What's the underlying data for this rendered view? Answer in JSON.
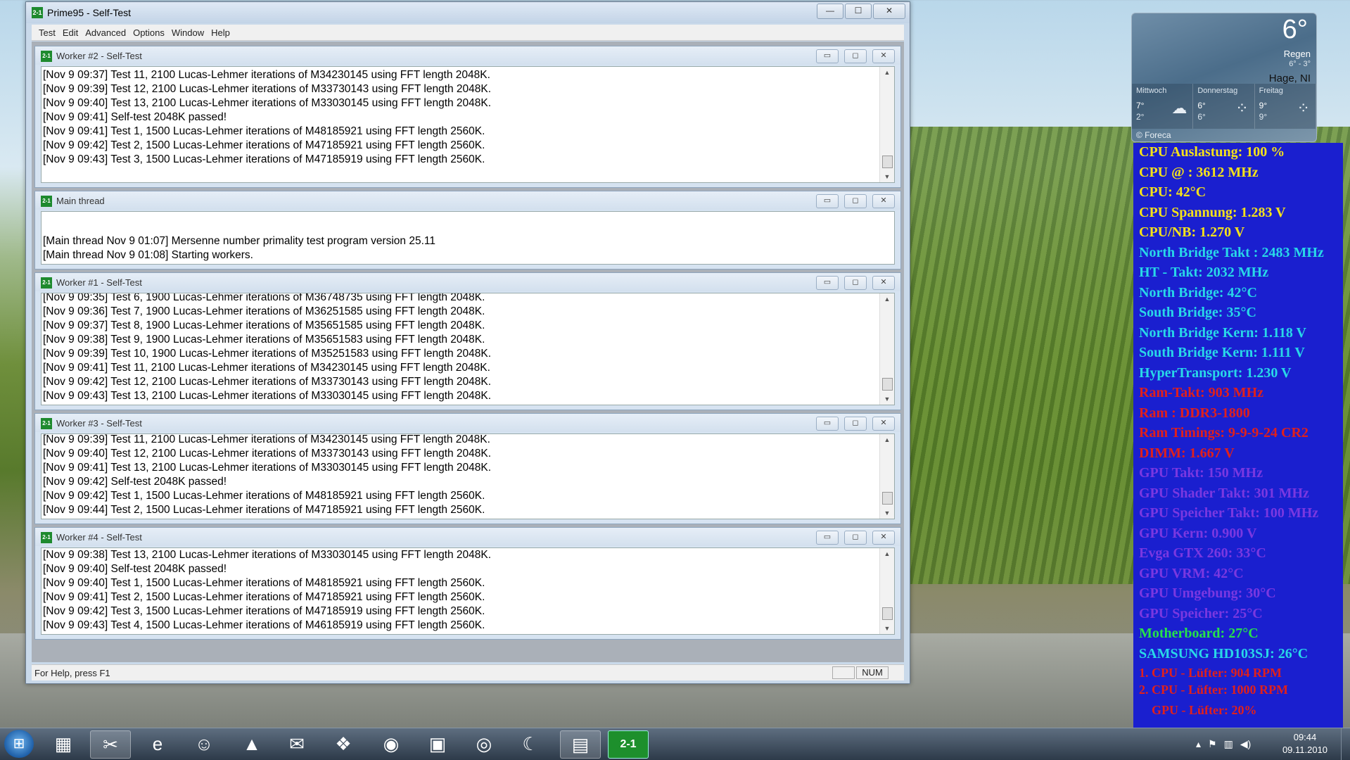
{
  "window": {
    "title": "Prime95 - Self-Test",
    "icon": "prime95-icon",
    "controls": {
      "minimize": "—",
      "maximize": "☐",
      "close": "✕"
    }
  },
  "menu": [
    "Test",
    "Edit",
    "Advanced",
    "Options",
    "Window",
    "Help"
  ],
  "children": [
    {
      "title": "Worker #2 - Self-Test",
      "lines": [
        "[Nov 9 09:37] Test 11, 2100 Lucas-Lehmer iterations of M34230145 using FFT length 2048K.",
        "[Nov 9 09:39] Test 12, 2100 Lucas-Lehmer iterations of M33730143 using FFT length 2048K.",
        "[Nov 9 09:40] Test 13, 2100 Lucas-Lehmer iterations of M33030145 using FFT length 2048K.",
        "[Nov 9 09:41] Self-test 2048K passed!",
        "[Nov 9 09:41] Test 1, 1500 Lucas-Lehmer iterations of M48185921 using FFT length 2560K.",
        "[Nov 9 09:42] Test 2, 1500 Lucas-Lehmer iterations of M47185921 using FFT length 2560K.",
        "[Nov 9 09:43] Test 3, 1500 Lucas-Lehmer iterations of M47185919 using FFT length 2560K.",
        ""
      ]
    },
    {
      "title": "Main thread",
      "lines": [
        "[Main thread Nov 9 01:07] Mersenne number primality test program version 25.11",
        "[Main thread Nov 9 01:08] Starting workers."
      ]
    },
    {
      "title": "Worker #1 - Self-Test",
      "lines": [
        "[Nov 9 09:35] Test 6, 1900 Lucas-Lehmer iterations of M36748735 using FFT length 2048K.",
        "[Nov 9 09:36] Test 7, 1900 Lucas-Lehmer iterations of M36251585 using FFT length 2048K.",
        "[Nov 9 09:37] Test 8, 1900 Lucas-Lehmer iterations of M35651585 using FFT length 2048K.",
        "[Nov 9 09:38] Test 9, 1900 Lucas-Lehmer iterations of M35651583 using FFT length 2048K.",
        "[Nov 9 09:39] Test 10, 1900 Lucas-Lehmer iterations of M35251583 using FFT length 2048K.",
        "[Nov 9 09:41] Test 11, 2100 Lucas-Lehmer iterations of M34230145 using FFT length 2048K.",
        "[Nov 9 09:42] Test 12, 2100 Lucas-Lehmer iterations of M33730143 using FFT length 2048K.",
        "[Nov 9 09:43] Test 13, 2100 Lucas-Lehmer iterations of M33030145 using FFT length 2048K."
      ]
    },
    {
      "title": "Worker #3 - Self-Test",
      "lines": [
        "[Nov 9 09:39] Test 11, 2100 Lucas-Lehmer iterations of M34230145 using FFT length 2048K.",
        "[Nov 9 09:40] Test 12, 2100 Lucas-Lehmer iterations of M33730143 using FFT length 2048K.",
        "[Nov 9 09:41] Test 13, 2100 Lucas-Lehmer iterations of M33030145 using FFT length 2048K.",
        "[Nov 9 09:42] Self-test 2048K passed!",
        "[Nov 9 09:42] Test 1, 1500 Lucas-Lehmer iterations of M48185921 using FFT length 2560K.",
        "[Nov 9 09:44] Test 2, 1500 Lucas-Lehmer iterations of M47185921 using FFT length 2560K."
      ]
    },
    {
      "title": "Worker #4 - Self-Test",
      "lines": [
        "[Nov 9 09:38] Test 13, 2100 Lucas-Lehmer iterations of M33030145 using FFT length 2048K.",
        "[Nov 9 09:40] Self-test 2048K passed!",
        "[Nov 9 09:40] Test 1, 1500 Lucas-Lehmer iterations of M48185921 using FFT length 2560K.",
        "[Nov 9 09:41] Test 2, 1500 Lucas-Lehmer iterations of M47185921 using FFT length 2560K.",
        "[Nov 9 09:42] Test 3, 1500 Lucas-Lehmer iterations of M47185919 using FFT length 2560K.",
        "[Nov 9 09:43] Test 4, 1500 Lucas-Lehmer iterations of M46185919 using FFT length 2560K."
      ]
    }
  ],
  "status": {
    "help": "For Help, press F1",
    "num": "NUM"
  },
  "weather": {
    "temp": "6°",
    "condition": "Regen",
    "range": "6° - 3°",
    "city": "Hage, NI",
    "days": [
      {
        "name": "Mittwoch",
        "hi": "7°",
        "lo": "2°",
        "icon": "cloud-icon",
        "glyph": "☁"
      },
      {
        "name": "Donnerstag",
        "hi": "6°",
        "lo": "6°",
        "icon": "rain-icon",
        "glyph": "⁘"
      },
      {
        "name": "Freitag",
        "hi": "9°",
        "lo": "9°",
        "icon": "rain-icon",
        "glyph": "⁘"
      }
    ],
    "credit": "© Foreca"
  },
  "sensors": [
    {
      "text": "CPU Auslastung: 100 %",
      "color": "#f5e21a"
    },
    {
      "text": "CPU @ : 3612 MHz",
      "color": "#f5e21a"
    },
    {
      "text": "CPU: 42°C",
      "color": "#f5e21a"
    },
    {
      "text": "CPU Spannung: 1.283 V",
      "color": "#f5e21a"
    },
    {
      "text": "CPU/NB: 1.270 V",
      "color": "#f5e21a"
    },
    {
      "text": "North Bridge Takt : 2483 MHz",
      "color": "#28d8e8"
    },
    {
      "text": "HT - Takt: 2032 MHz",
      "color": "#28d8e8"
    },
    {
      "text": "North Bridge: 42°C",
      "color": "#28d8e8"
    },
    {
      "text": "South Bridge: 35°C",
      "color": "#28d8e8"
    },
    {
      "text": "North Bridge Kern: 1.118 V",
      "color": "#28d8e8"
    },
    {
      "text": "South Bridge Kern: 1.111 V",
      "color": "#28d8e8"
    },
    {
      "text": "HyperTransport: 1.230 V",
      "color": "#28d8e8"
    },
    {
      "text": "Ram-Takt: 903 MHz",
      "color": "#e0201c"
    },
    {
      "text": "Ram : DDR3-1800",
      "color": "#e0201c"
    },
    {
      "text": "Ram Timings: 9-9-9-24 CR2",
      "color": "#e0201c"
    },
    {
      "text": "DIMM: 1.667 V",
      "color": "#e0201c"
    },
    {
      "text": "GPU Takt: 150 MHz",
      "color": "#7a38e0"
    },
    {
      "text": "GPU Shader Takt: 301 MHz",
      "color": "#7a38e0"
    },
    {
      "text": "GPU Speicher Takt: 100 MHz",
      "color": "#7a38e0"
    },
    {
      "text": "GPU Kern: 0.900 V",
      "color": "#7a38e0"
    },
    {
      "text": "Evga GTX 260: 33°C",
      "color": "#7a38e0"
    },
    {
      "text": "GPU VRM: 42°C",
      "color": "#7a38e0"
    },
    {
      "text": "GPU Umgebung: 30°C",
      "color": "#7a38e0"
    },
    {
      "text": "GPU Speicher: 25°C",
      "color": "#7a38e0"
    },
    {
      "text": "Motherboard: 27°C",
      "color": "#26e24a"
    },
    {
      "text": "SAMSUNG HD103SJ: 26°C",
      "color": "#28d8e8"
    },
    {
      "text": "1. CPU - Lüfter: 904 RPM",
      "color": "#e0201c"
    },
    {
      "text": "2. CPU - Lüfter: 1000 RPM",
      "color": "#e0201c"
    },
    {
      "text": "GPU - Lüfter: 20%",
      "color": "#e0201c"
    }
  ],
  "taskbar": {
    "apps": [
      {
        "name": "calculator-taskbar-icon",
        "glyph": "▦"
      },
      {
        "name": "snipping-tool-taskbar-icon",
        "glyph": "✂"
      },
      {
        "name": "internet-explorer-taskbar-icon",
        "glyph": "e"
      },
      {
        "name": "users-taskbar-icon",
        "glyph": "☺"
      },
      {
        "name": "vlc-taskbar-icon",
        "glyph": "▲"
      },
      {
        "name": "mail-taskbar-icon",
        "glyph": "✉"
      },
      {
        "name": "python-taskbar-icon",
        "glyph": "❖"
      },
      {
        "name": "steam-taskbar-icon",
        "glyph": "◉"
      },
      {
        "name": "cube-taskbar-icon",
        "glyph": "▣"
      },
      {
        "name": "red-circle-taskbar-icon",
        "glyph": "◎"
      },
      {
        "name": "bird-taskbar-icon",
        "glyph": "☾"
      },
      {
        "name": "explorer-taskbar-icon",
        "glyph": "▤"
      },
      {
        "name": "prime95-taskbar-icon",
        "glyph": "2-1"
      }
    ],
    "time": "09:44",
    "date": "09.11.2010"
  }
}
